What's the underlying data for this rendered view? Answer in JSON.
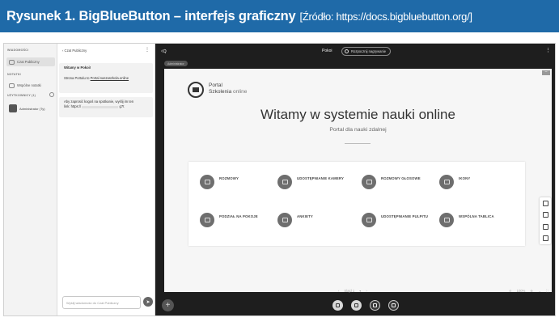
{
  "caption": {
    "title": "Rysunek 1. BigBlueButton – interfejs graficzny",
    "source": "[Źródło: https://docs.bigbluebutton.org/]",
    "bg_color": "#1f6aa8"
  },
  "sidebar": {
    "messages_title": "WIADOMOŚCI",
    "public_chat": "Czat Publiczny",
    "notes_title": "NOTATKI",
    "shared_notes": "Wspólne notatki",
    "users_title": "UŻYTKOWNICY (1)",
    "user_name": "Administrator (Ty)"
  },
  "chat": {
    "header": "‹ Czat Publiczny",
    "welcome_title": "Witamy w Pokoi!",
    "welcome_line": "Strona Portalu to",
    "welcome_link": "Portal.naszaszkola.online",
    "invite_line1": "Aby zaprosić kogoś na spotkanie, wyślij im ten",
    "invite_line2": "link: https://",
    "invite_suffix": "g7t",
    "input_placeholder": "Wyślij wiadomość do Czat Publiczny"
  },
  "main": {
    "meeting_name": "Pokoi",
    "record_label": "Rozpocznij nagrywanie",
    "presenter_label": "Administrator",
    "slide": {
      "logo_line1": "Portal",
      "logo_line2a": "Szkolenia",
      "logo_line2b": "online",
      "title": "Witamy w systemie nauki online",
      "subtitle": "Portal dla nauki zdalnej",
      "features": [
        {
          "icon": "chat-icon",
          "label": "ROZMOWY"
        },
        {
          "icon": "camera-icon",
          "label": "UDOSTĘPNIANIE KAMERY"
        },
        {
          "icon": "microphone-icon",
          "label": "ROZMOWY GŁOSOWE"
        },
        {
          "icon": "emoji-icon",
          "label": "IKONY"
        },
        {
          "icon": "rooms-icon",
          "label": "PODZIAŁ NA POKOJE"
        },
        {
          "icon": "poll-icon",
          "label": "ANKIETY"
        },
        {
          "icon": "screen-share-icon",
          "label": "UDOSTĘPNIANIE PULPITU"
        },
        {
          "icon": "whiteboard-icon",
          "label": "WSPÓLNA TABLICA"
        }
      ]
    },
    "slide_nav": "Slajd 1",
    "zoom": "100%"
  }
}
